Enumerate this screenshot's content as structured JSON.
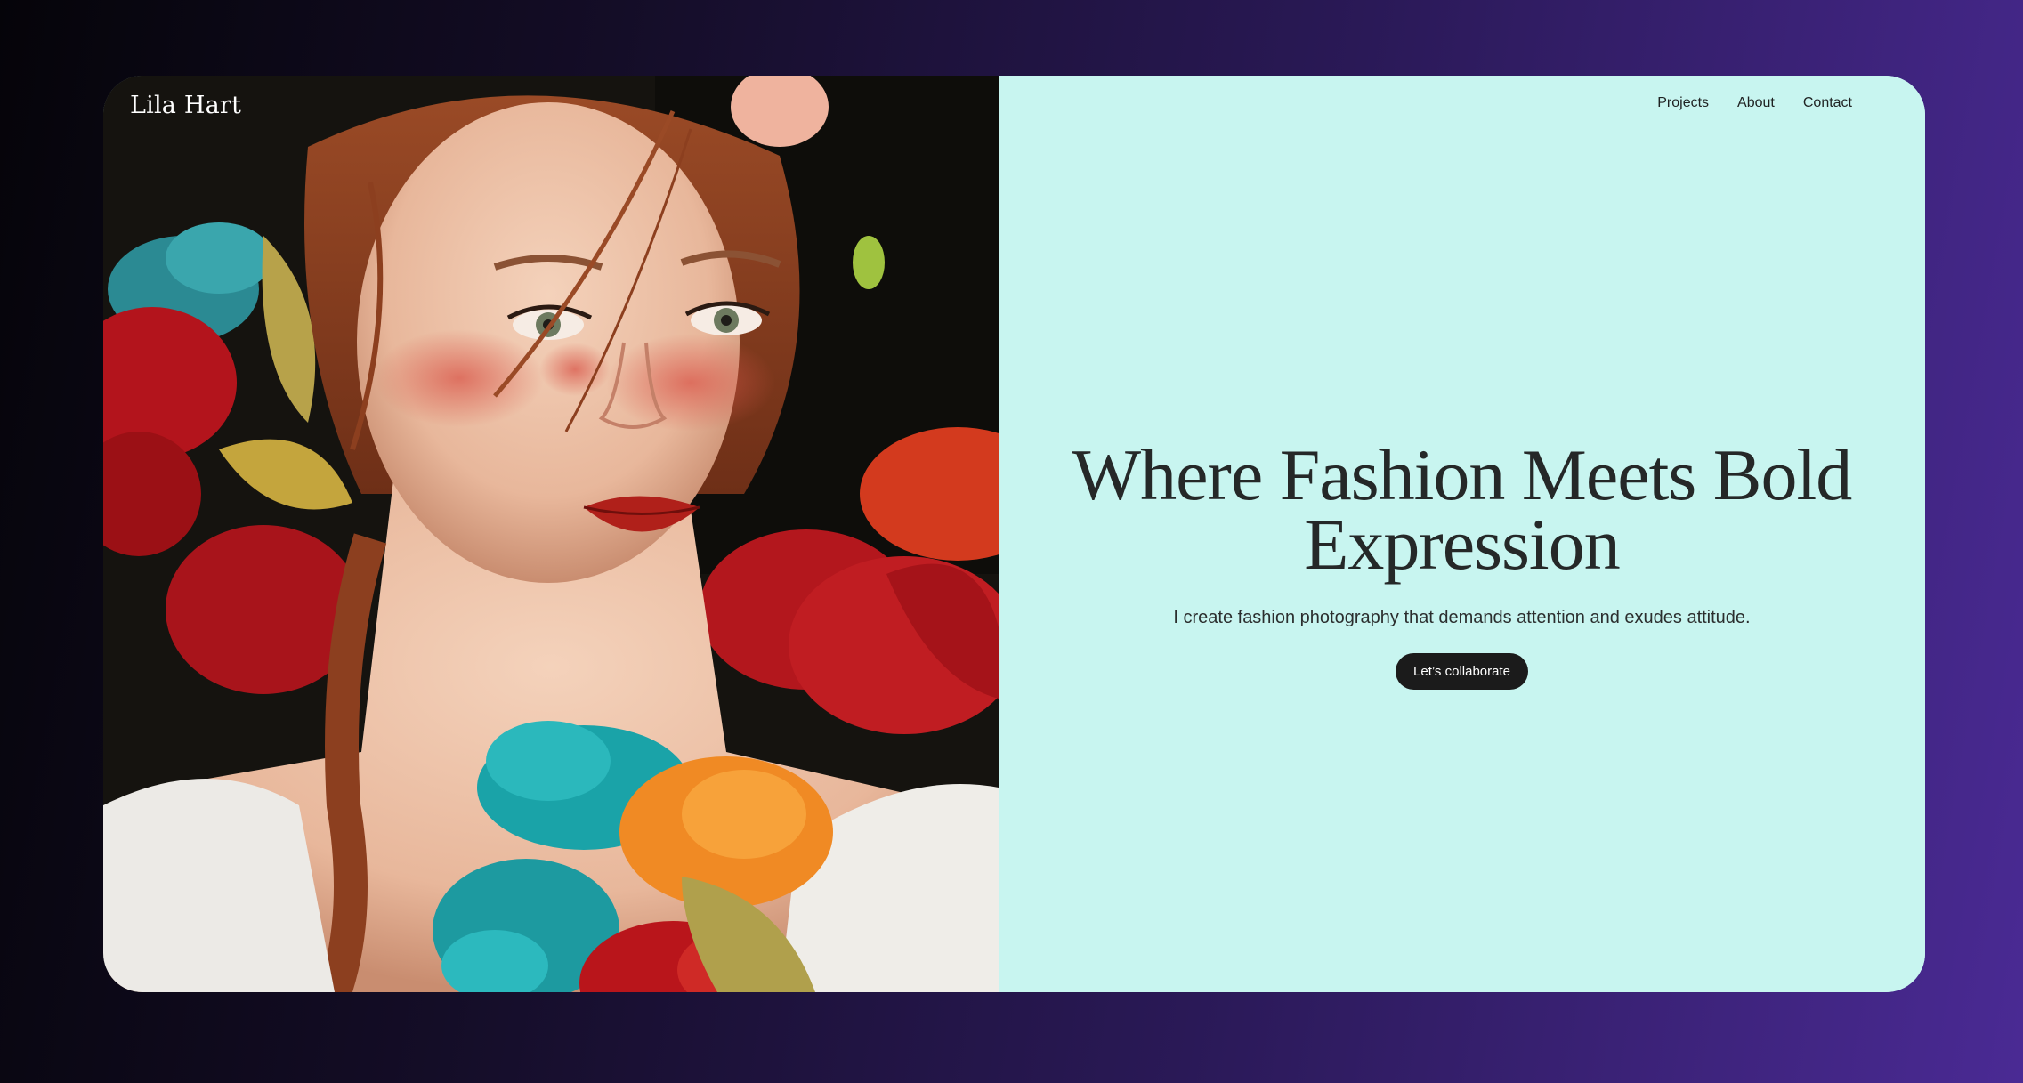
{
  "brand": {
    "name": "Lila Hart"
  },
  "nav": {
    "items": [
      "Projects",
      "About",
      "Contact"
    ]
  },
  "hero": {
    "headline": "Where Fashion Meets Bold Expression",
    "subtitle": "I create fashion photography that demands attention and exudes attitude.",
    "cta_label": "Let’s collaborate"
  },
  "colors": {
    "accent_panel": "#c8f5f0",
    "button": "#1b1b1b",
    "text": "#252828",
    "background_gradient_end": "#4a2a94"
  }
}
